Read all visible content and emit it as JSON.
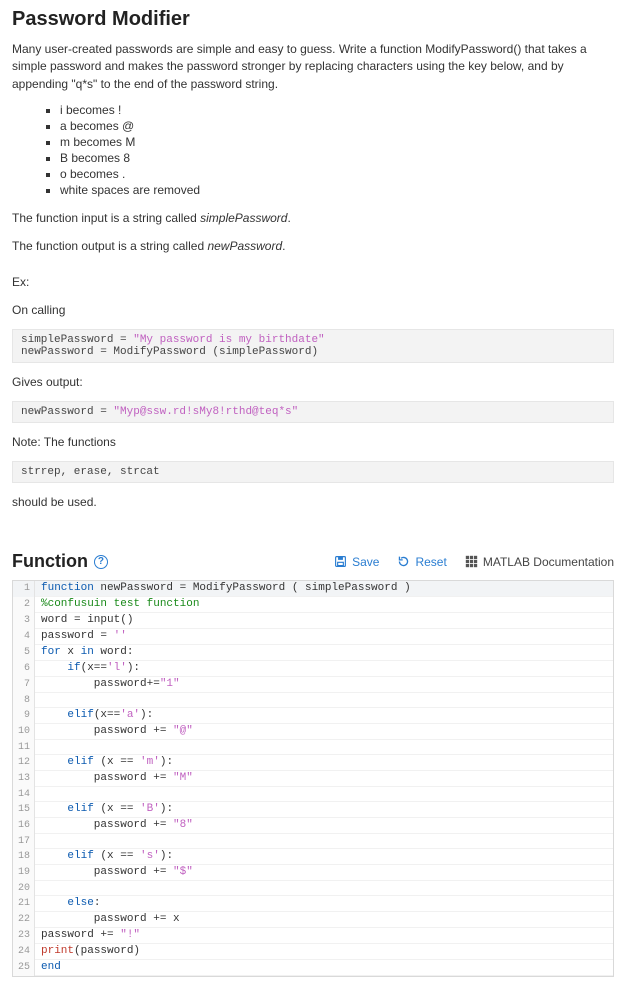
{
  "title": "Password Modifier",
  "intro": "Many user-created passwords are simple and easy to guess. Write a function ModifyPassword() that takes a simple password and makes the password stronger by replacing characters using the key below, and by appending \"q*s\" to the end of the password string.",
  "rules": [
    "i becomes !",
    "a becomes @",
    "m becomes M",
    "B becomes 8",
    "o becomes .",
    "white spaces are removed"
  ],
  "input_line_pre": "The function input is a string called ",
  "input_var": "simplePassword",
  "output_line_pre": "The function output is a string called ",
  "output_var": "newPassword",
  "ex_label": "Ex:",
  "on_calling": "On calling",
  "code_example_in_plain": "simplePassword = ",
  "code_example_in_str": "\"My password is my birthdate\"",
  "code_example_in_line2": "newPassword = ModifyPassword (simplePassword)",
  "gives_output": "Gives output:",
  "code_example_out_plain": "newPassword = ",
  "code_example_out_str": "\"Myp@ssw.rd!sMy8!rthd@teq*s\"",
  "note_label": "Note:  The functions",
  "funcs_line": "strrep, erase, strcat",
  "should_be_used": "should be used.",
  "section_title": "Function",
  "save_label": "Save",
  "reset_label": "Reset",
  "docs_label": "MATLAB Documentation",
  "code_lines": [
    {
      "n": 1,
      "html": "<span class='tok-kw'>function</span> newPassword = ModifyPassword ( simplePassword )"
    },
    {
      "n": 2,
      "html": "<span class='tok-com'>%confusuin test function</span>"
    },
    {
      "n": 3,
      "html": "word = input()"
    },
    {
      "n": 4,
      "html": "password = <span class='tok-str'>''</span>"
    },
    {
      "n": 5,
      "html": "<span class='tok-kw'>for</span> x <span class='tok-kw'>in</span> word:"
    },
    {
      "n": 6,
      "html": "    <span class='tok-kw'>if</span>(x==<span class='tok-str'>'l'</span>):"
    },
    {
      "n": 7,
      "html": "        password+=<span class='tok-str'>\"1\"</span>"
    },
    {
      "n": 8,
      "html": ""
    },
    {
      "n": 9,
      "html": "    <span class='tok-kw'>elif</span>(x==<span class='tok-str'>'a'</span>):"
    },
    {
      "n": 10,
      "html": "        password += <span class='tok-str'>\"@\"</span>"
    },
    {
      "n": 11,
      "html": ""
    },
    {
      "n": 12,
      "html": "    <span class='tok-kw'>elif</span> (x == <span class='tok-str'>'m'</span>):"
    },
    {
      "n": 13,
      "html": "        password += <span class='tok-str'>\"M\"</span>"
    },
    {
      "n": 14,
      "html": ""
    },
    {
      "n": 15,
      "html": "    <span class='tok-kw'>elif</span> (x == <span class='tok-str'>'B'</span>):"
    },
    {
      "n": 16,
      "html": "        password += <span class='tok-str'>\"8\"</span>"
    },
    {
      "n": 17,
      "html": ""
    },
    {
      "n": 18,
      "html": "    <span class='tok-kw'>elif</span> (x == <span class='tok-str'>'s'</span>):"
    },
    {
      "n": 19,
      "html": "        password += <span class='tok-str'>\"$\"</span>"
    },
    {
      "n": 20,
      "html": ""
    },
    {
      "n": 21,
      "html": "    <span class='tok-kw'>else</span>:"
    },
    {
      "n": 22,
      "html": "        password += x"
    },
    {
      "n": 23,
      "html": "password += <span class='tok-str'>\"!\"</span>"
    },
    {
      "n": 24,
      "html": "<span class='tok-red'>print</span>(password)"
    },
    {
      "n": 25,
      "html": "<span class='tok-kw'>end</span>"
    }
  ]
}
